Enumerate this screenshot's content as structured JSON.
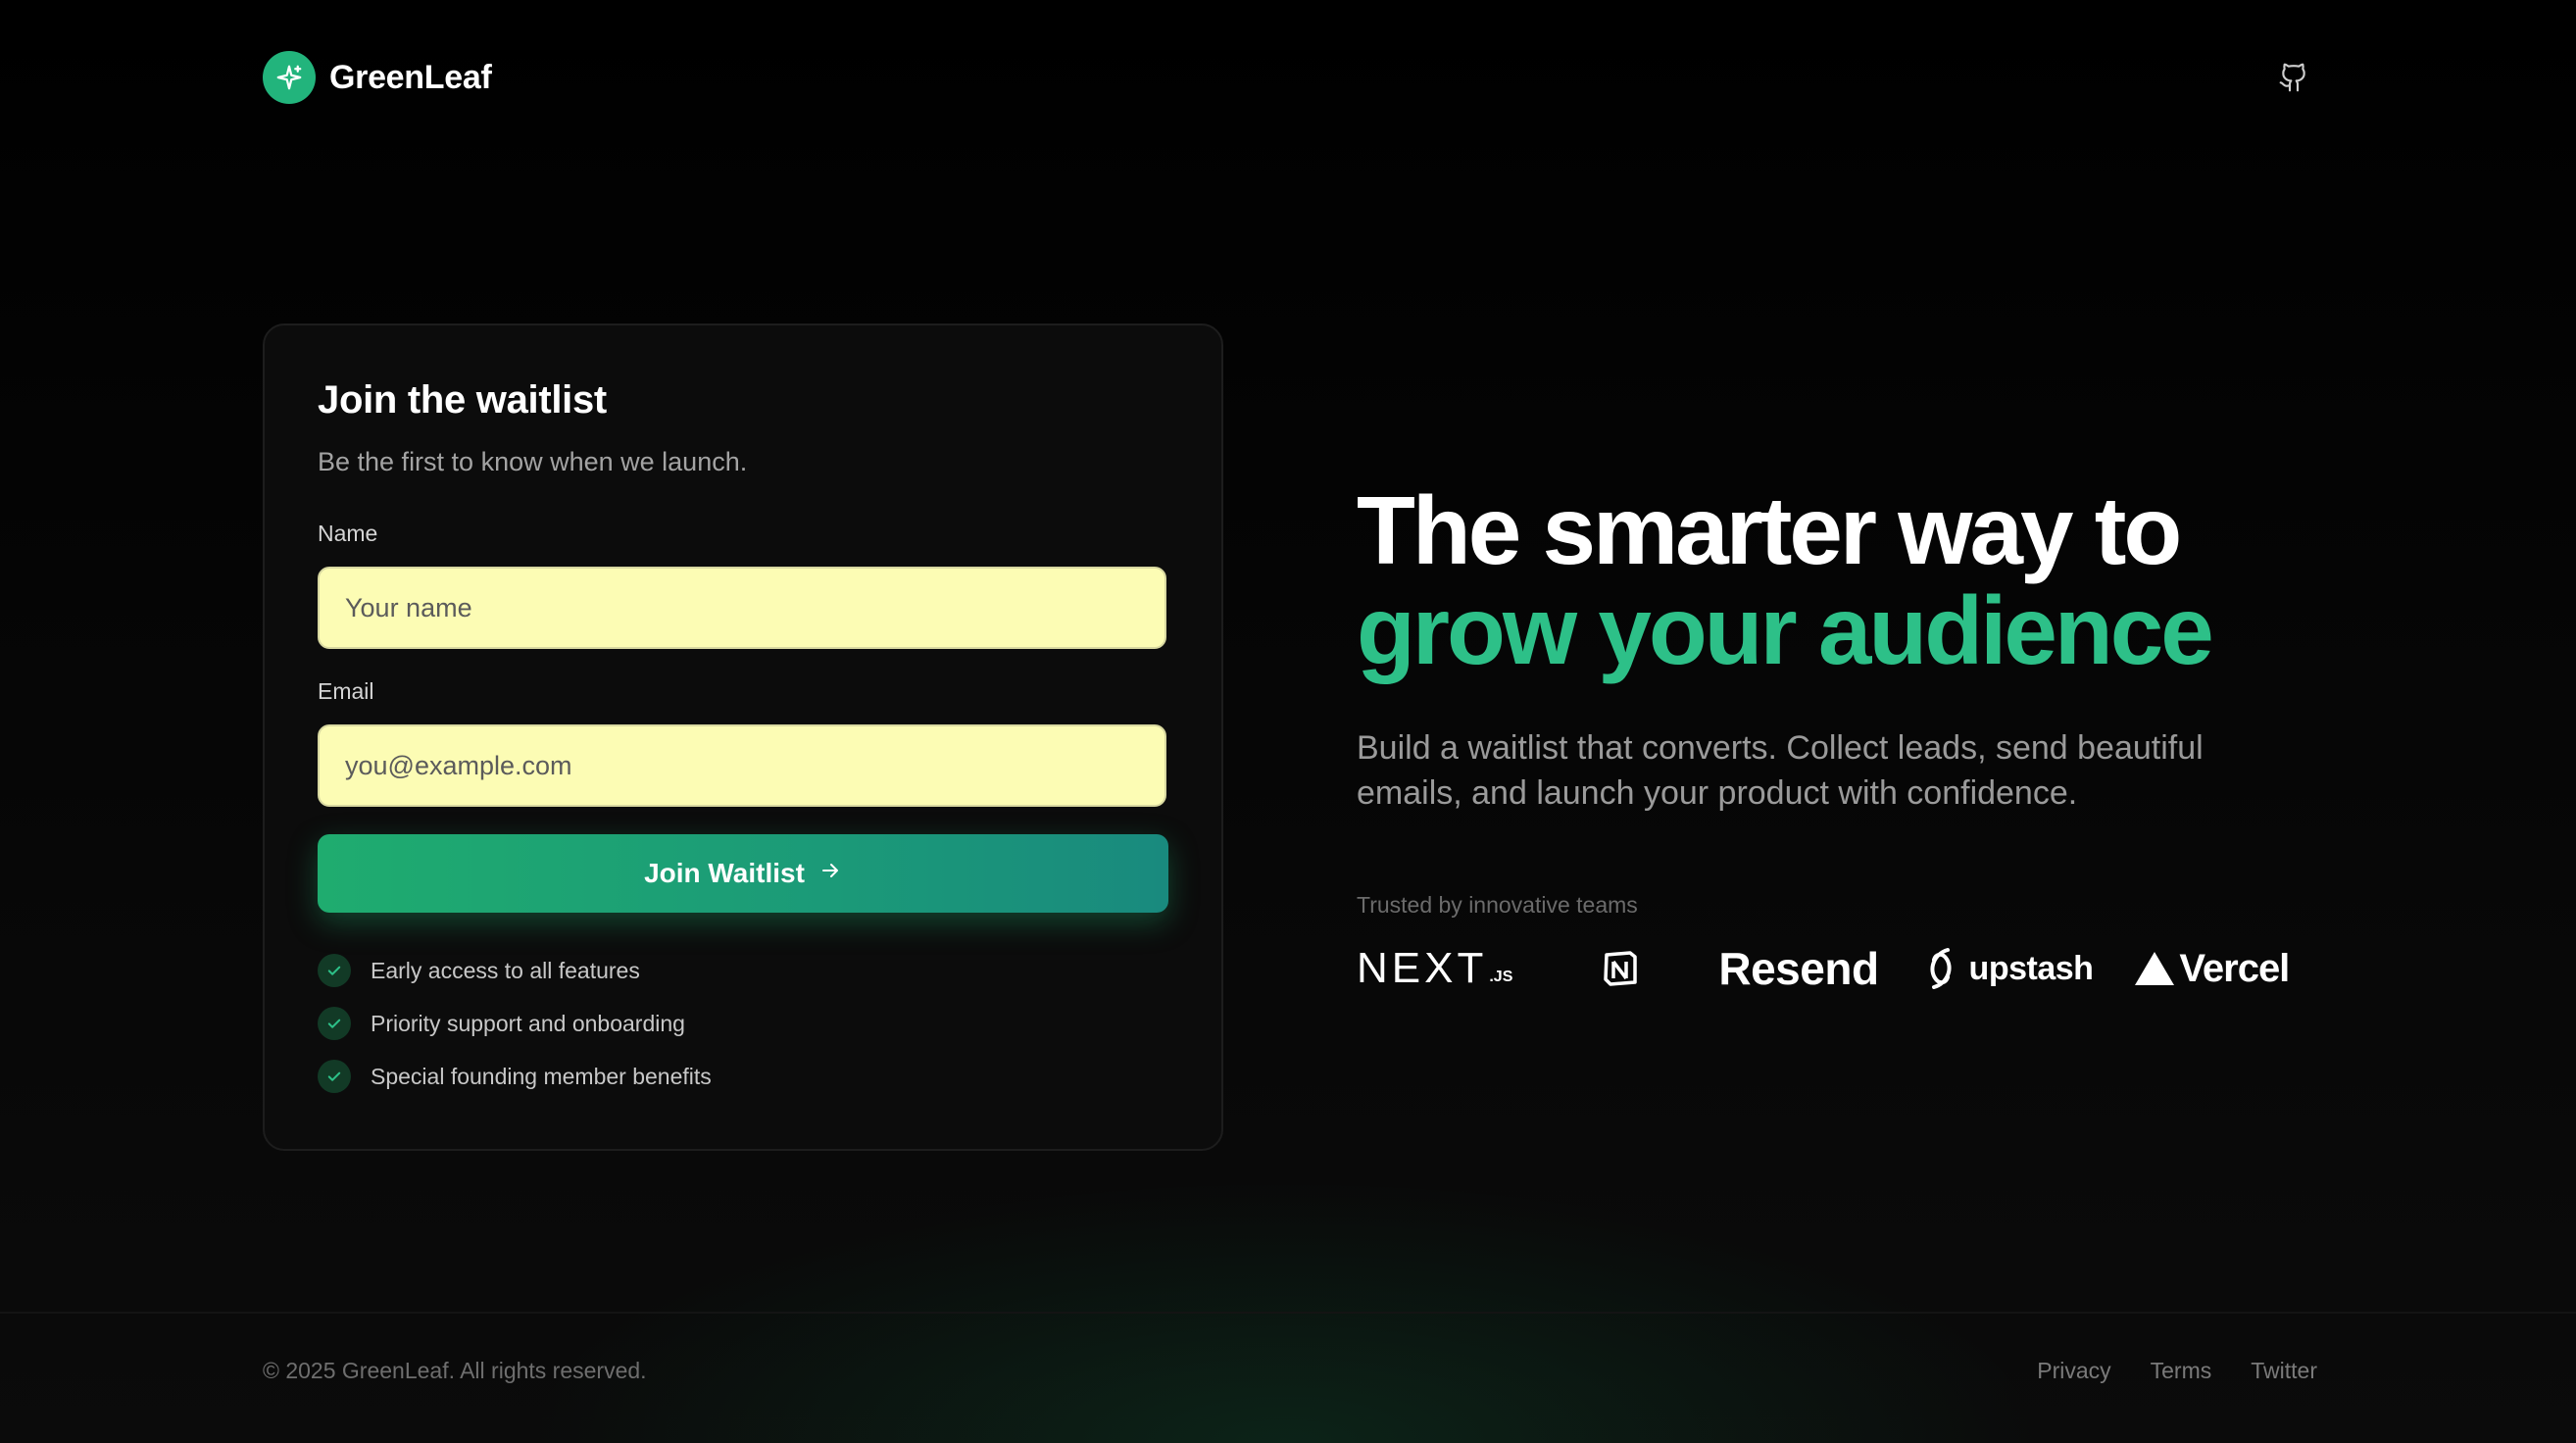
{
  "brand": {
    "name": "GreenLeaf",
    "logo_icon": "sparkle-icon",
    "accent": "#22b47c"
  },
  "header": {
    "github_icon": "github-icon"
  },
  "waitlist": {
    "title": "Join the waitlist",
    "subtitle": "Be the first to know when we launch.",
    "name_label": "Name",
    "name_placeholder": "Your name",
    "name_value": "",
    "email_label": "Email",
    "email_placeholder": "you@example.com",
    "email_value": "",
    "submit_label": "Join Waitlist",
    "submit_icon": "arrow-right-icon",
    "benefits": [
      "Early access to all features",
      "Priority support and onboarding",
      "Special founding member benefits"
    ]
  },
  "hero": {
    "line1": "The smarter way to",
    "line2": "grow your audience",
    "description": "Build a waitlist that converts. Collect leads, send beautiful emails, and launch your product with confidence.",
    "trusted_label": "Trusted by innovative teams",
    "logos": [
      "NEXT.js",
      "Notion",
      "Resend",
      "upstash",
      "Vercel"
    ],
    "logo_next_main": "NEXT",
    "logo_next_suffix": ".JS",
    "logo_resend": "Resend",
    "logo_upstash": "upstash",
    "logo_vercel": "Vercel"
  },
  "footer": {
    "copyright": "© 2025 GreenLeaf. All rights reserved.",
    "links": [
      "Privacy",
      "Terms",
      "Twitter"
    ]
  },
  "colors": {
    "background": "#050505",
    "card": "#0c0c0c",
    "input_bg": "#fcfcb4",
    "button_gradient_start": "#1fac6f",
    "button_gradient_end": "#198a7e",
    "headline_accent": "#2dc088"
  }
}
